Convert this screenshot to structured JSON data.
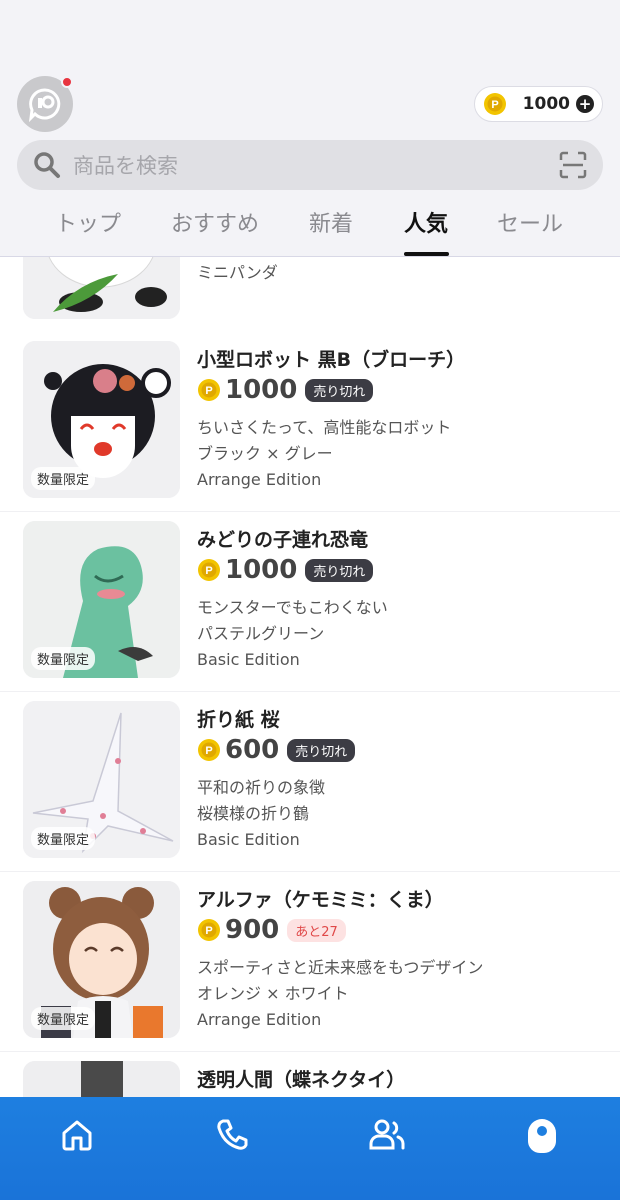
{
  "header": {
    "coin_balance": "1000",
    "search_placeholder": "商品を検索"
  },
  "tabs": [
    {
      "label": "トップ"
    },
    {
      "label": "おすすめ"
    },
    {
      "label": "新着"
    },
    {
      "label": "人気",
      "active": true
    },
    {
      "label": "セール"
    }
  ],
  "items": [
    {
      "name": "",
      "lines": [
        "ミニパンダ"
      ]
    },
    {
      "name": "小型ロボット 黒B（ブローチ）",
      "price": "1000",
      "badge": "売り切れ",
      "badge_type": "sold",
      "limited": "数量限定",
      "lines": [
        "ちいさくたって、高性能なロボット",
        "ブラック × グレー",
        "Arrange Edition"
      ]
    },
    {
      "name": "みどりの子連れ恐竜",
      "price": "1000",
      "badge": "売り切れ",
      "badge_type": "sold",
      "limited": "数量限定",
      "lines": [
        "モンスターでもこわくない",
        "パステルグリーン",
        "Basic Edition"
      ]
    },
    {
      "name": "折り紙 桜",
      "price": "600",
      "badge": "売り切れ",
      "badge_type": "sold",
      "limited": "数量限定",
      "lines": [
        "平和の祈りの象徴",
        "桜模様の折り鶴",
        "Basic Edition"
      ]
    },
    {
      "name": "アルファ（ケモミミ：くま）",
      "price": "900",
      "badge": "あと27",
      "badge_type": "remaining",
      "limited": "数量限定",
      "lines": [
        "スポーティさと近未来感をもつデザイン",
        "オレンジ × ホワイト",
        "Arrange Edition"
      ]
    },
    {
      "name": "透明人間（蝶ネクタイ）"
    }
  ],
  "colors": {
    "accent_blue": "#1e7fe0",
    "coin_yellow": "#f2c400",
    "notification_red": "#e8343f"
  },
  "icons": [
    "chat-avatar-icon",
    "coin-icon",
    "plus-icon",
    "search-icon",
    "scan-icon",
    "home-icon",
    "phone-icon",
    "friends-icon",
    "profile-icon"
  ]
}
